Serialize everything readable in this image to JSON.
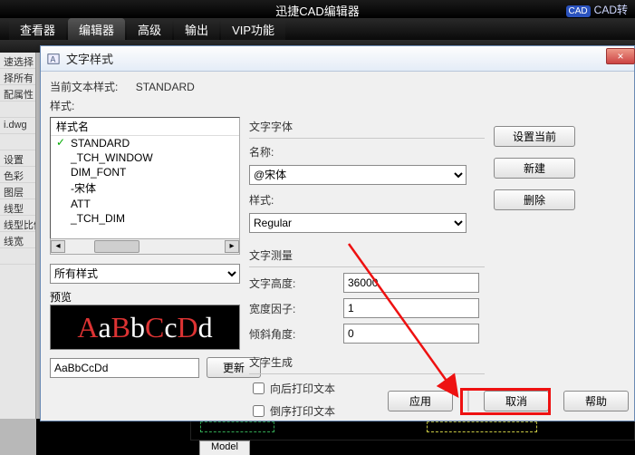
{
  "app": {
    "title": "迅捷CAD编辑器",
    "right_badge": "CAD",
    "right_text": "CAD转",
    "tabs": [
      "查看器",
      "编辑器",
      "高级",
      "输出",
      "VIP功能"
    ],
    "active_tab_index": 1,
    "model_tab": "Model"
  },
  "side": {
    "items": [
      "速选择",
      "择所有",
      "配属性",
      "",
      "i.dwg",
      "",
      "设置",
      "色彩",
      "图层",
      "线型",
      "线型比例",
      "线宽",
      ""
    ]
  },
  "dlg": {
    "title": "文字样式",
    "current_label": "当前文本样式:",
    "current_value": "STANDARD",
    "styles_label": "样式:",
    "name_header": "样式名",
    "styles": [
      "STANDARD",
      "_TCH_WINDOW",
      "DIM_FONT",
      "-宋体",
      "ATT",
      "_TCH_DIM"
    ],
    "current_style_index": 0,
    "filter_value": "所有样式",
    "preview_label": "预览",
    "preview_sample": "AaBbCcDd",
    "preview_input": "AaBbCcDd",
    "refresh_btn": "更新",
    "font_group": "文字字体",
    "name_label": "名称:",
    "font_value": "@宋体",
    "style_label": "样式:",
    "style_value": "Regular",
    "meas_group": "文字测量",
    "height_label": "文字高度:",
    "height_value": "36000",
    "widthf_label": "宽度因子:",
    "widthf_value": "1",
    "oblique_label": "倾斜角度:",
    "oblique_value": "0",
    "gen_group": "文字生成",
    "chk_back": "向后打印文本",
    "chk_upside": "倒序打印文本",
    "right_btns": {
      "set_current": "设置当前",
      "new": "新建",
      "delete": "删除"
    },
    "bottom": {
      "apply": "应用",
      "cancel": "取消",
      "help": "帮助"
    },
    "close": "×"
  }
}
